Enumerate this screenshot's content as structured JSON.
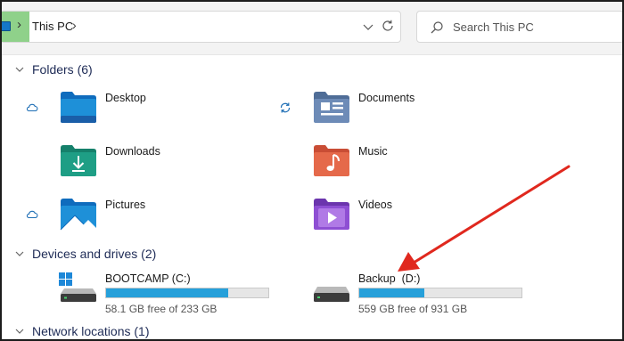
{
  "address_bar": {
    "crumbs": [
      "This PC"
    ]
  },
  "search": {
    "placeholder": "Search This PC"
  },
  "sections": {
    "folders": "Folders (6)",
    "devices": "Devices and drives (2)",
    "network": "Network locations (1)"
  },
  "folders": [
    {
      "label": "Desktop",
      "icon": "desktop-folder-icon",
      "color": "#1e90d8",
      "status": "cloud"
    },
    {
      "label": "Documents",
      "icon": "documents-folder-icon",
      "color": "#6d8bb7",
      "status": "sync"
    },
    {
      "label": "Downloads",
      "icon": "downloads-folder-icon",
      "color": "#1e9e85",
      "status": ""
    },
    {
      "label": "Music",
      "icon": "music-folder-icon",
      "color": "#e5694a",
      "status": ""
    },
    {
      "label": "Pictures",
      "icon": "pictures-folder-icon",
      "color": "#1e90d8",
      "status": "cloud"
    },
    {
      "label": "Videos",
      "icon": "videos-folder-icon",
      "color": "#8e4fd3",
      "status": ""
    }
  ],
  "drives": [
    {
      "name": "BOOTCAMP (C:)",
      "free": "58.1 GB free of 233 GB",
      "used_fraction": 0.75,
      "icon": "windows-drive-icon"
    },
    {
      "name": "Backup  (D:)",
      "free": "559 GB free of 931 GB",
      "used_fraction": 0.4,
      "icon": "drive-icon"
    }
  ],
  "colors": {
    "accent": "#26a0da",
    "annotation_arrow": "#e0281e",
    "highlight": "#8fd18a"
  }
}
